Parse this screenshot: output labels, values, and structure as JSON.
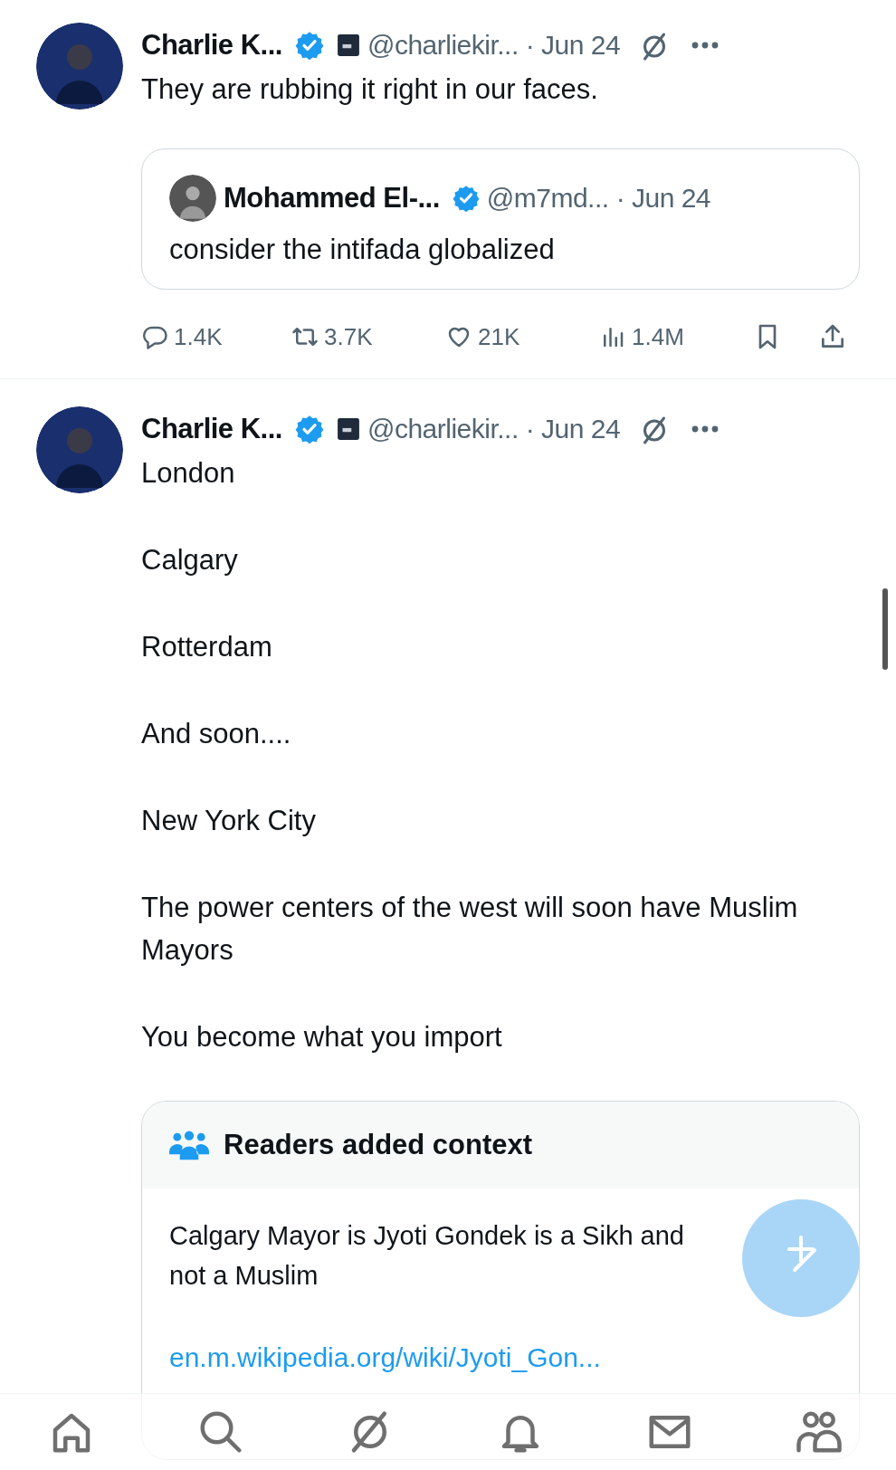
{
  "tweets": [
    {
      "author": "Charlie K...",
      "verified": true,
      "affiliate": true,
      "handle": "@charliekir...",
      "time": "· Jun 24",
      "paragraphs": [
        "They are rubbing it right in our faces."
      ],
      "quote": {
        "author": "Mohammed El-...",
        "verified": true,
        "handle": "@m7md...",
        "time": "· Jun 24",
        "text": "consider the intifada globalized"
      },
      "stats": [
        {
          "kind": "reply",
          "count": "1.4K"
        },
        {
          "kind": "repost",
          "count": "3.7K"
        },
        {
          "kind": "like",
          "count": "21K"
        },
        {
          "kind": "views",
          "count": "1.4M"
        },
        {
          "kind": "bookmark"
        },
        {
          "kind": "share"
        }
      ]
    },
    {
      "author": "Charlie K...",
      "verified": true,
      "affiliate": true,
      "handle": "@charliekir...",
      "time": "· Jun 24",
      "paragraphs": [
        "London",
        "Calgary",
        "Rotterdam",
        "And soon....",
        "New York City",
        "The power centers of the west will soon have Muslim Mayors",
        "You become what you import"
      ],
      "note": {
        "title": "Readers added context",
        "text": "Calgary Mayor is Jyoti Gondek is a Sikh and not a Muslim",
        "link": "en.m.wikipedia.org/wiki/Jyoti_Gon..."
      }
    }
  ],
  "bottom_nav": [
    {
      "kind": "home"
    },
    {
      "kind": "search"
    },
    {
      "kind": "grok"
    },
    {
      "kind": "notifications"
    },
    {
      "kind": "messages"
    },
    {
      "kind": "communities"
    }
  ]
}
